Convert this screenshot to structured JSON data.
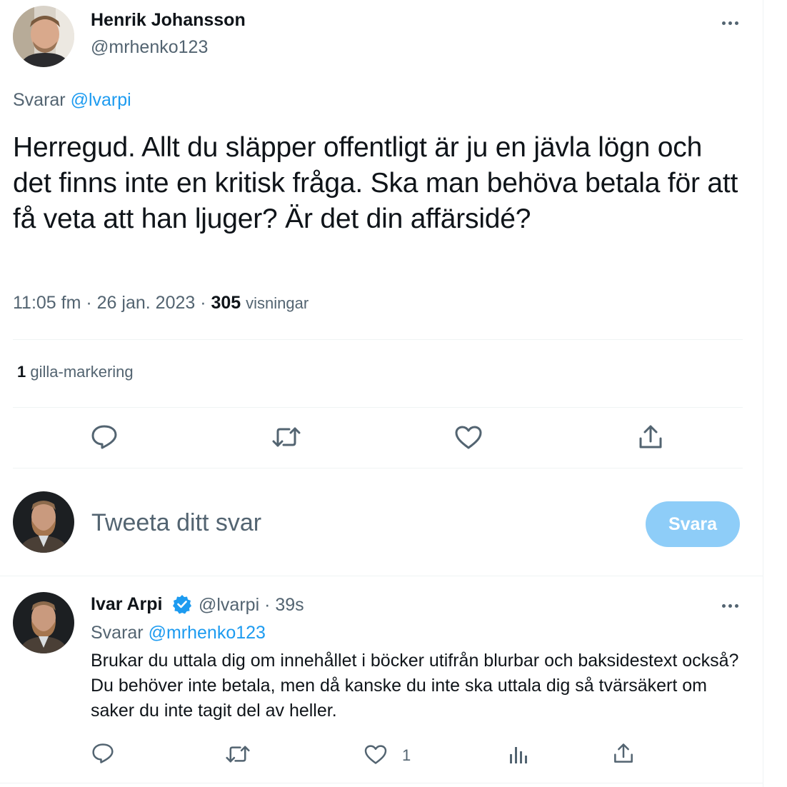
{
  "tweet": {
    "author_name": "Henrik Johansson",
    "author_handle": "@mrhenko123",
    "reply_prefix": "Svarar",
    "reply_to": "@lvarpi",
    "text": "Herregud. Allt du släpper offentligt är ju en jävla lögn och det finns inte en kritisk fråga. Ska man behöva betala för att få veta att han ljuger? Är det din affärsidé?",
    "time": "11:05 fm",
    "date": "26 jan. 2023",
    "views_count": "305",
    "views_label": "visningar",
    "likes_count": "1",
    "likes_label": "gilla-markering"
  },
  "compose": {
    "placeholder": "Tweeta ditt svar",
    "submit_label": "Svara"
  },
  "reply": {
    "author_name": "Ivar Arpi",
    "author_handle": "@lvarpi",
    "time_ago": "39s",
    "reply_prefix": "Svarar",
    "reply_to": "@mrhenko123",
    "text": "Brukar du uttala dig om innehållet i böcker utifrån blurbar och baksidestext också? Du behöver inte betala, men då kanske du inte ska uttala dig så tvärsäkert om saker du inte tagit del av heller.",
    "likes_count": "1"
  },
  "colors": {
    "text_primary": "#0f1419",
    "text_secondary": "#536471",
    "link": "#1d9bf0",
    "button_disabled": "#8ecdf8",
    "divider": "#eff3f4"
  },
  "icons": [
    "reply-icon",
    "retweet-icon",
    "like-icon",
    "share-icon",
    "views-icon",
    "verified-icon",
    "more-icon"
  ]
}
